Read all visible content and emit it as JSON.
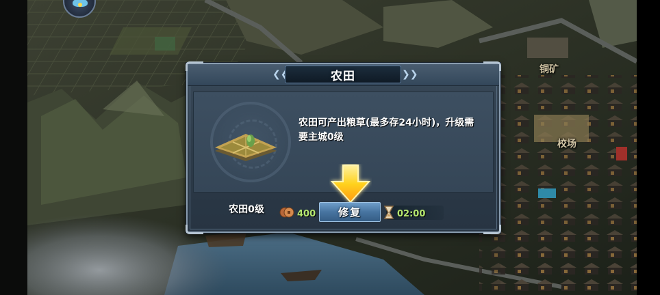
{
  "map": {
    "labels": {
      "copper_mine": "铜矿",
      "training_ground": "校场"
    }
  },
  "dialog": {
    "title": "农田",
    "building_name": "农田0级",
    "description": "农田可产出粮草(最多存24小时)，升级需要主城0级",
    "cost": "400",
    "repair_button": "修复",
    "time": "02:00"
  },
  "colors": {
    "accent_green": "#b6e86f",
    "button_blue": "#4774a0",
    "arrow_yellow": "#ffd21f",
    "panel": "#354657"
  },
  "icons": {
    "coin": "copper-coin-icon",
    "timer": "hourglass-icon",
    "arrow": "down-arrow-icon",
    "avatar": "bird-avatar-icon"
  }
}
